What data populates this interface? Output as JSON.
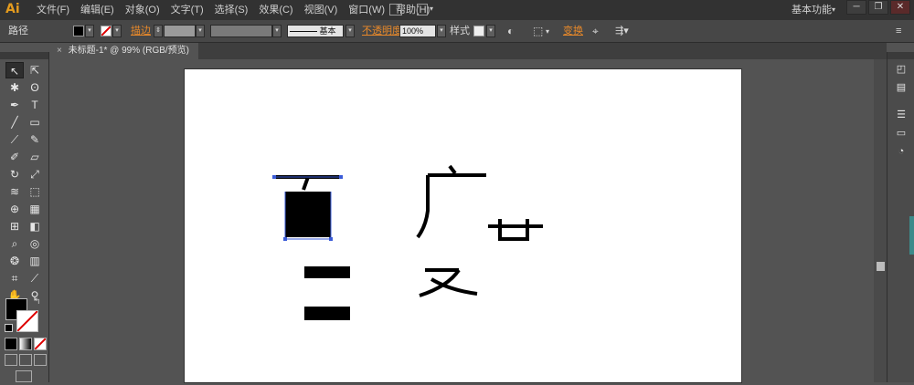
{
  "app": {
    "logo": "Ai",
    "workspace": "基本功能"
  },
  "menu": [
    "文件(F)",
    "编辑(E)",
    "对象(O)",
    "文字(T)",
    "选择(S)",
    "效果(C)",
    "视图(V)",
    "窗口(W)",
    "帮助(H)"
  ],
  "window_controls": {
    "minimize": "─",
    "restore": "❐",
    "close": "✕"
  },
  "control": {
    "selection": "路径",
    "stroke_label": "描边",
    "brush_label": "基本",
    "opacity_label": "不透明度",
    "opacity_value": "100%",
    "style_label": "样式",
    "transform_label": "变换"
  },
  "document": {
    "tab": "未标题-1* @ 99% (RGB/预览)",
    "close": "×"
  },
  "colors": {
    "accent": "#e8892a",
    "selection": "#3a5bd8",
    "fill": "#000000"
  }
}
